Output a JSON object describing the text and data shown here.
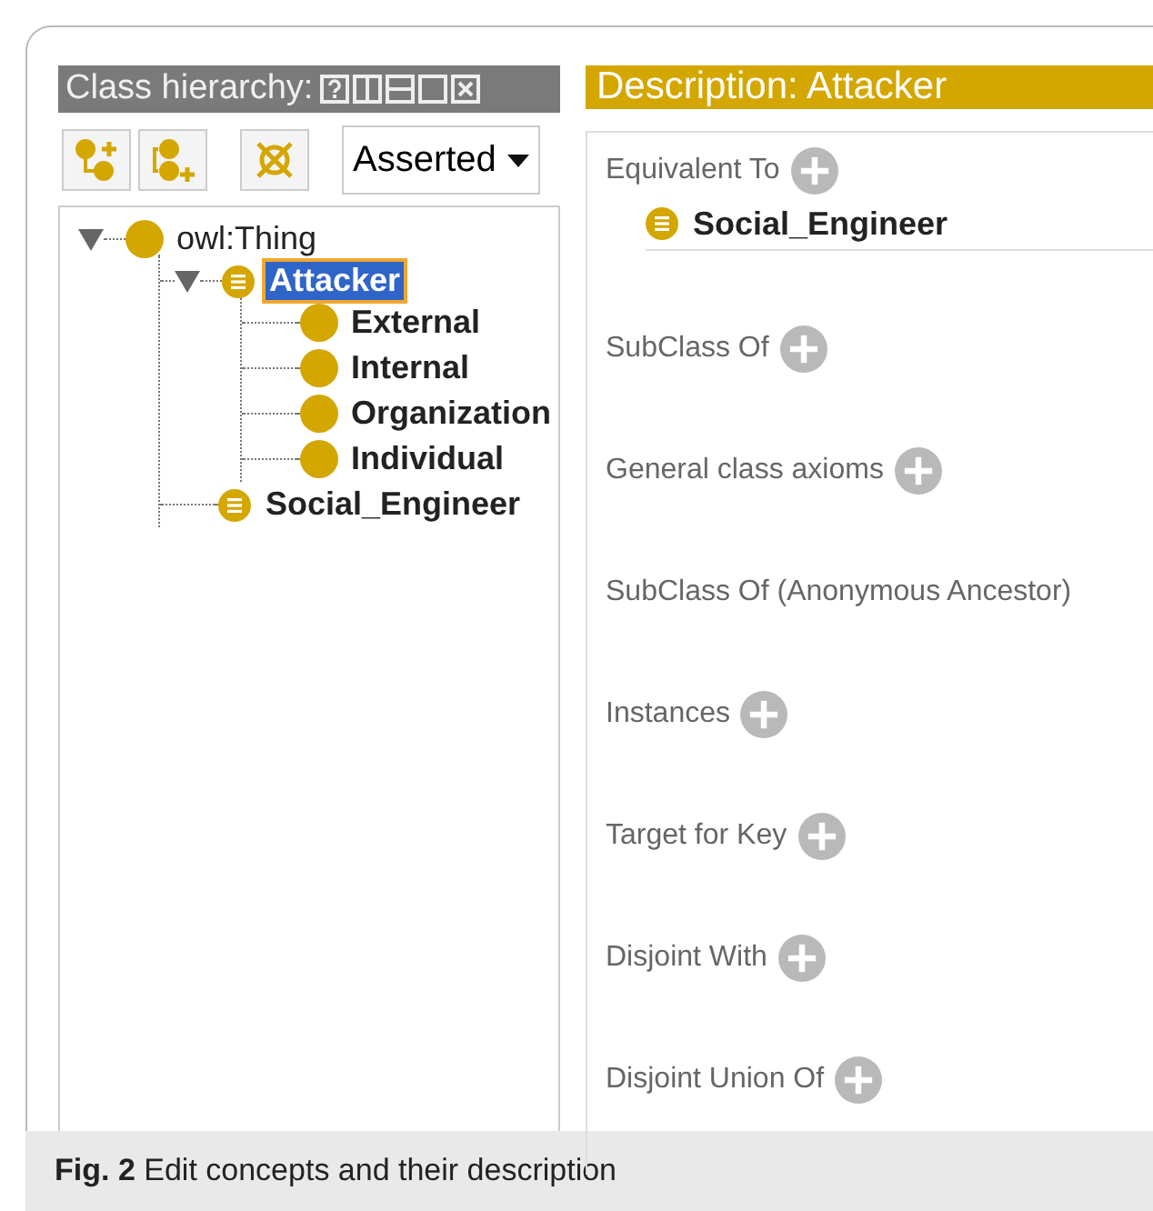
{
  "hierarchy": {
    "title": "Class hierarchy:",
    "reasoner_select": {
      "value": "Asserted"
    },
    "tree": [
      {
        "label": "owl:Thing",
        "kind": "builtin",
        "expanded": true,
        "selected": false,
        "children": [
          {
            "label": "Attacker",
            "kind": "defined",
            "expanded": true,
            "selected": true,
            "children": [
              {
                "label": "External",
                "kind": "class",
                "selected": false
              },
              {
                "label": "Internal",
                "kind": "class",
                "selected": false
              },
              {
                "label": "Organization",
                "kind": "class",
                "selected": false
              },
              {
                "label": "Individual",
                "kind": "class",
                "selected": false
              }
            ]
          },
          {
            "label": "Social_Engineer",
            "kind": "defined",
            "selected": false
          }
        ]
      }
    ]
  },
  "description": {
    "title": "Description: Attacker",
    "sections": [
      {
        "title": "Equivalent To",
        "add": true,
        "items": [
          {
            "label": "Social_Engineer",
            "kind": "defined"
          }
        ]
      },
      {
        "title": "SubClass Of",
        "add": true
      },
      {
        "title": "General class axioms",
        "add": true
      },
      {
        "title": "SubClass Of (Anonymous Ancestor)",
        "add": false
      },
      {
        "title": "Instances",
        "add": true
      },
      {
        "title": "Target for Key",
        "add": true
      },
      {
        "title": "Disjoint With",
        "add": true
      },
      {
        "title": "Disjoint Union Of",
        "add": true
      }
    ]
  },
  "caption": "**Fig. 2** Edit concepts and their description"
}
